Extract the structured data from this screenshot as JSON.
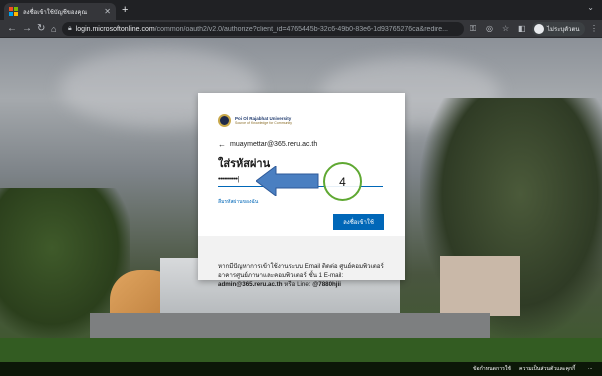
{
  "browser": {
    "tab_title": "ลงชื่อเข้าใช้บัญชีของคุณ",
    "tab_close": "✕",
    "new_tab": "+",
    "url_host": "login.microsoftonline.com",
    "url_path": "/common/oauth2/v2.0/authorize?client_id=4765445b-32c6-49b0-83e6-1d93765276ca&redire...",
    "profile_name": "ไม่ระบุตัวตน",
    "menu": "⋮",
    "logo_colors": [
      "#f25022",
      "#7fba00",
      "#00a4ef",
      "#ffb900"
    ]
  },
  "card": {
    "brand_name": "Poi Ol Rajabhat University",
    "brand_sub": "Source of Knowledge for Community",
    "identity_email": "muaymettar@365.reru.ac.th",
    "heading": "ใส่รหัสผ่าน",
    "password_value": "••••••••••|",
    "forgot_link": "ลืมรหัสผ่านของฉัน",
    "signin_label": "ลงชื่อเข้าใช้",
    "help_line": "หากมีปัญหาการเข้าใช้งานระบบ Email ติดต่อ ศูนย์คอมพิวเตอร์ อาคารศูนย์ภาษาและคอมพิวเตอร์ ชั้น 1 E-mail:",
    "help_email": "admin@365.reru.ac.th",
    "help_or_line": "หรือ Line:",
    "help_line_id": "@7880hjii"
  },
  "annotation": {
    "step_number": "4",
    "arrow_color": "#4a7fc1",
    "circle_color": "#5fa832"
  },
  "footer": {
    "terms": "ข้อกำหนดการใช้",
    "privacy": "ความเป็นส่วนตัวและคุกกี้",
    "more": "..."
  }
}
